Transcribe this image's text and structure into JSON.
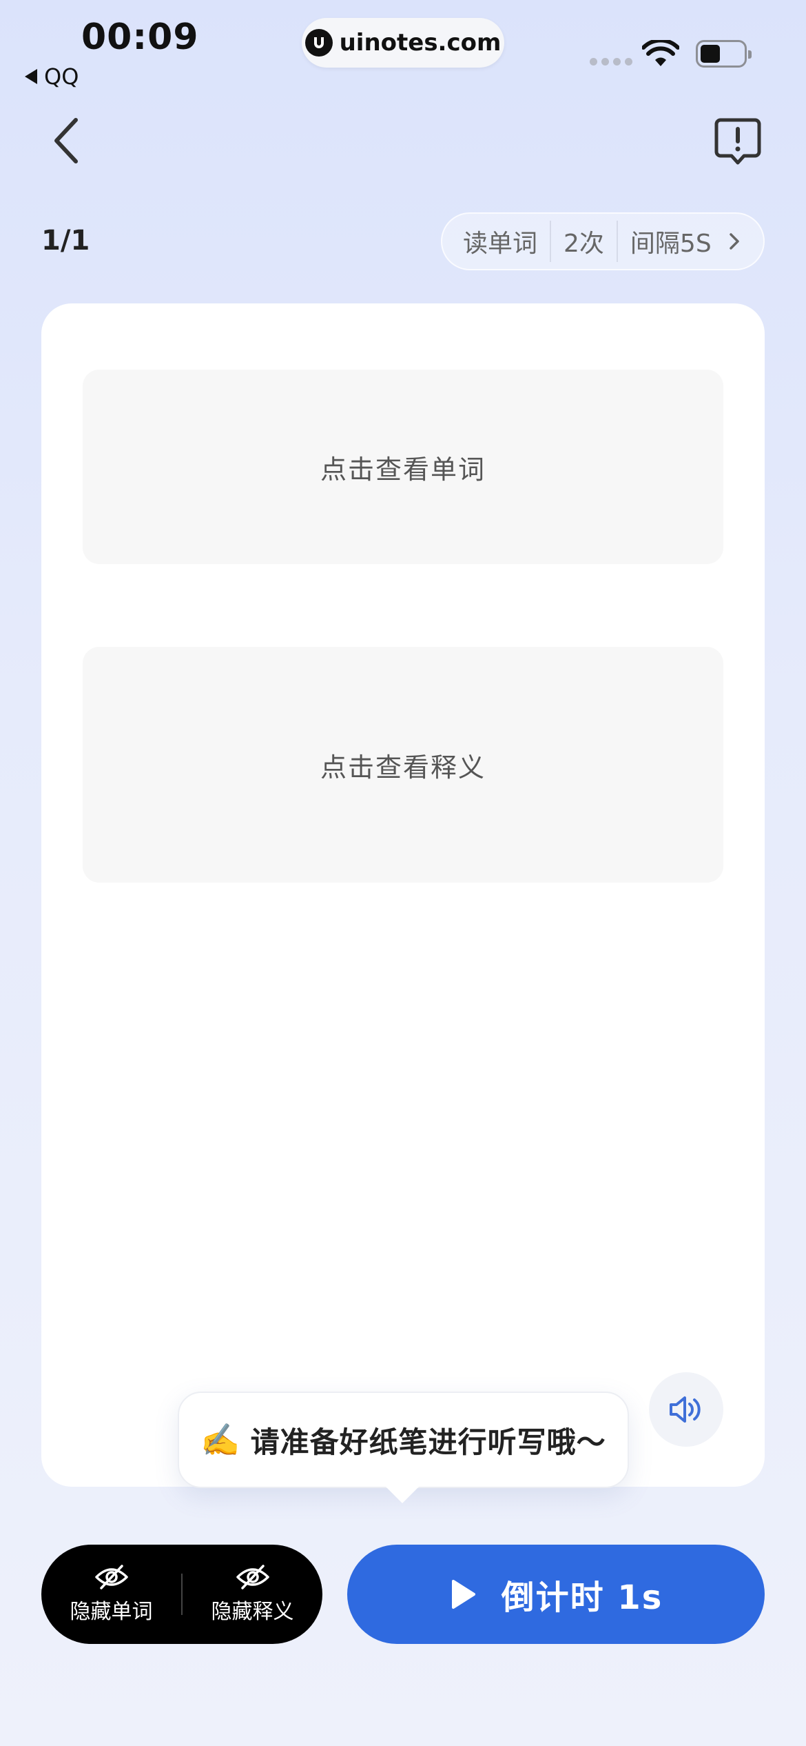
{
  "status_bar": {
    "time": "00:09",
    "back_app": "QQ",
    "url": "uinotes.com"
  },
  "progress": "1/1",
  "settings": {
    "mode": "读单词",
    "repeat": "2次",
    "interval": "间隔5S"
  },
  "card": {
    "word_placeholder": "点击查看单词",
    "meaning_placeholder": "点击查看释义"
  },
  "tooltip": {
    "emoji": "✍️",
    "text": "请准备好纸笔进行听写哦～"
  },
  "controls": {
    "hide_word": "隐藏单词",
    "hide_meaning": "隐藏释义",
    "countdown": "倒计时 1s"
  },
  "colors": {
    "accent": "#2f6ae0",
    "sound_icon": "#3f6fd8",
    "background_top": "#dbe3fb",
    "background_bottom": "#eef1fb"
  }
}
